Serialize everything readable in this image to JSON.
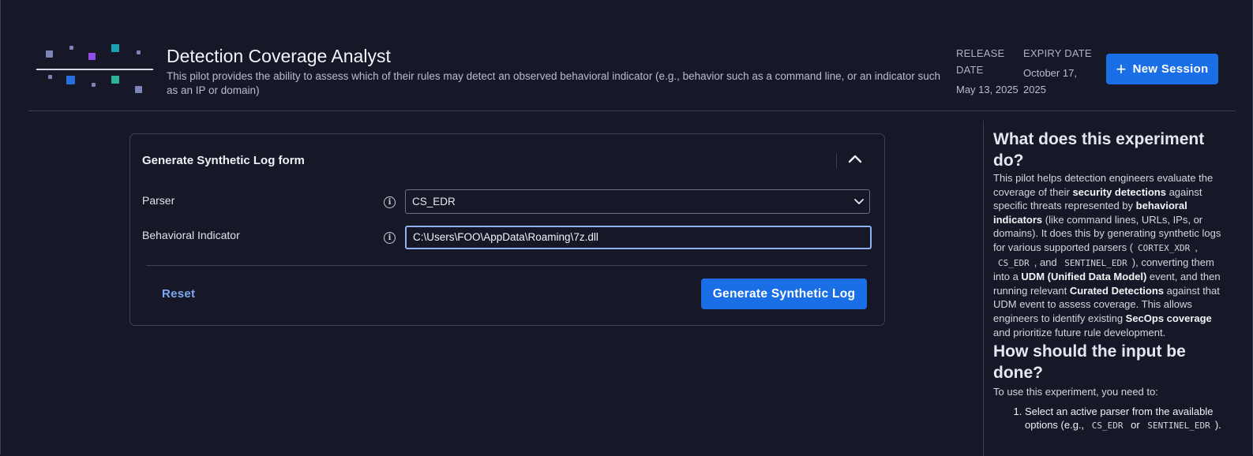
{
  "header": {
    "title": "Detection Coverage Analyst",
    "subtitle": "This pilot provides the ability to assess which of their rules may detect an observed behavioral indicator (e.g., behavior such as a command line, or an indicator such as an IP or domain)",
    "release_label_1": "RELEASE",
    "release_label_2": "DATE",
    "release_value": "May 13, 2025",
    "expiry_label": "EXPIRY DATE",
    "expiry_value_1": "October 17,",
    "expiry_value_2": "2025",
    "new_session_label": "New Session",
    "logo_colors": [
      "#7b85b8",
      "#8f4fe6",
      "#16a3b3",
      "#2a6fe0",
      "#2bb39a"
    ]
  },
  "form": {
    "title": "Generate Synthetic Log form",
    "parser_label": "Parser",
    "parser_value": "CS_EDR",
    "indicator_label": "Behavioral Indicator",
    "indicator_value": "C:\\Users\\FOO\\AppData\\Roaming\\7z.dll",
    "reset_label": "Reset",
    "generate_label": "Generate Synthetic Log"
  },
  "panel": {
    "heading1": "What does this experiment do?",
    "p1_t1": "This pilot helps detection engineers evaluate the coverage of their ",
    "p1_b1": "security detections",
    "p1_t2": " against specific threats represented by ",
    "p1_b2": "behavioral indicators",
    "p1_t3": " (like command lines, URLs, IPs, or domains). It does this by generating synthetic logs for various supported parsers (",
    "p1_c1": "CORTEX_XDR",
    "p1_t4": ", ",
    "p1_c2": "CS_EDR",
    "p1_t5": ", and ",
    "p1_c3": "SENTINEL_EDR",
    "p1_t6": "), converting them into a ",
    "p1_b3": "UDM (Unified Data Model)",
    "p1_t7": " event, and then running relevant ",
    "p1_b4": "Curated Detections",
    "p1_t8": " against that UDM event to assess coverage. This allows engineers to identify existing ",
    "p1_b5": "SecOps coverage",
    "p1_t9": " and prioritize future rule development.",
    "heading2": "How should the input be done?",
    "p2": "To use this experiment, you need to:",
    "li1_t1": "Select an active parser from the available options (e.g., ",
    "li1_c1": "CS_EDR",
    "li1_t2": " or ",
    "li1_c2": "SENTINEL_EDR",
    "li1_t3": ")."
  }
}
